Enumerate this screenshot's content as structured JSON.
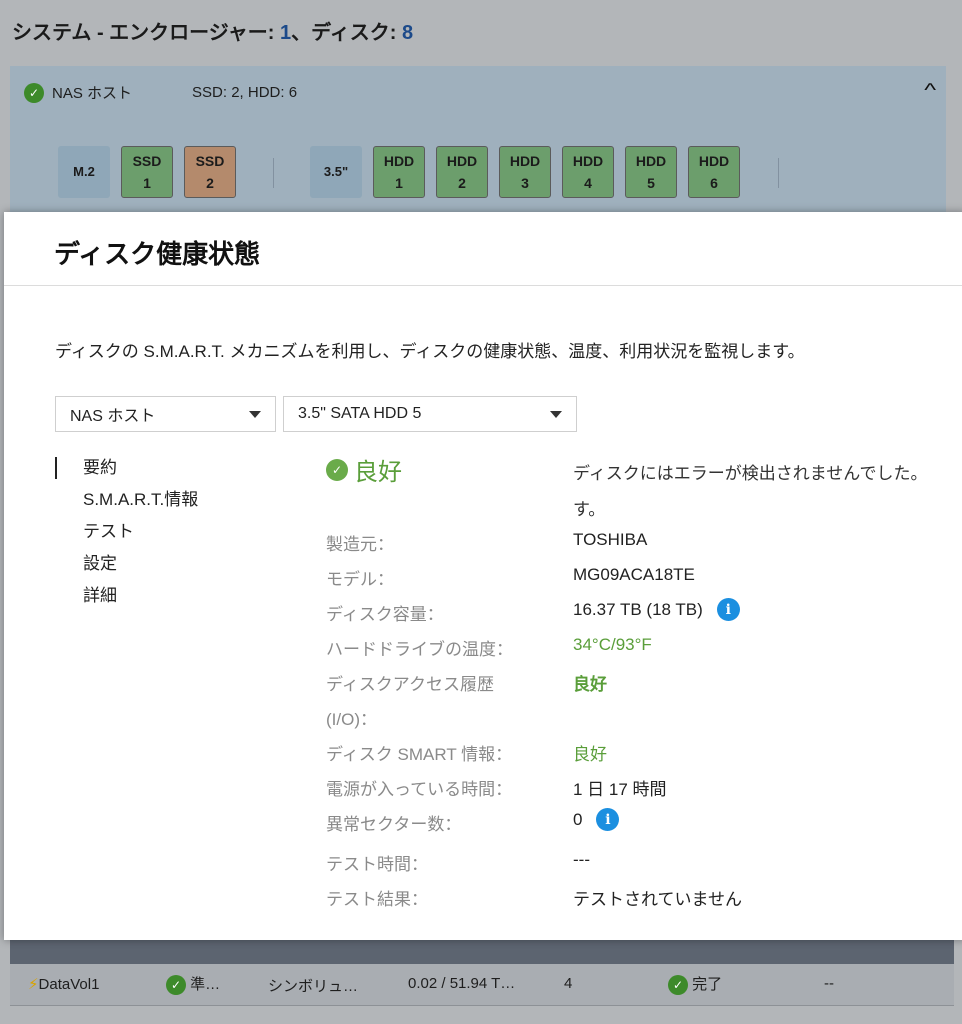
{
  "background": {
    "title_prefix": "システム - エンクロージャー: ",
    "enclosure_count": "1",
    "title_mid": "、ディスク: ",
    "disk_count": "8",
    "host_name": "NAS ホスト",
    "host_summary": "SSD: 2, HDD: 6",
    "bays": [
      {
        "line1": "M.2",
        "line2": "",
        "kind": "label"
      },
      {
        "line1": "SSD",
        "line2": "1",
        "kind": "green"
      },
      {
        "line1": "SSD",
        "line2": "2",
        "kind": "orange"
      },
      {
        "line1": "3.5\"",
        "line2": "",
        "kind": "label"
      },
      {
        "line1": "HDD",
        "line2": "1",
        "kind": "green"
      },
      {
        "line1": "HDD",
        "line2": "2",
        "kind": "green"
      },
      {
        "line1": "HDD",
        "line2": "3",
        "kind": "green"
      },
      {
        "line1": "HDD",
        "line2": "4",
        "kind": "green"
      },
      {
        "line1": "HDD",
        "line2": "5",
        "kind": "green"
      },
      {
        "line1": "HDD",
        "line2": "6",
        "kind": "green"
      }
    ],
    "table_row": {
      "name": "DataVol1",
      "status": "準…",
      "type": "シンボリュ…",
      "capacity": "0.02 / 51.94 T…",
      "snapshots": "4",
      "snapshot_status": "完了",
      "last": "--"
    }
  },
  "modal": {
    "title": "ディスク健康状態",
    "description": "ディスクの S.M.A.R.T. メカニズムを利用し、ディスクの健康状態、温度、利用状況を監視します。",
    "host_select": "NAS ホスト",
    "disk_select": "3.5\" SATA HDD 5",
    "nav": [
      "要約",
      "S.M.A.R.T.情報",
      "テスト",
      "設定",
      "詳細"
    ],
    "status": "良好",
    "status_message_line1": "ディスクにはエラーが検出されませんでした。",
    "status_message_line2": "す。",
    "fields": {
      "manufacturer_label": "製造元：",
      "manufacturer": "TOSHIBA",
      "model_label": "モデル：",
      "model": "MG09ACA18TE",
      "capacity_label": "ディスク容量：",
      "capacity": "16.37 TB (18 TB)",
      "temp_label": "ハードドライブの温度：",
      "temp": "34°C/93°F",
      "access_label_line1": "ディスクアクセス履歴",
      "access_label_line2": "(I/O)：",
      "access": "良好",
      "smart_label": "ディスク SMART 情報：",
      "smart": "良好",
      "power_label": "電源が入っている時間：",
      "power": "1 日 17 時間",
      "bad_sector_label": "異常セクター数：",
      "bad_sector": "0",
      "test_time_label": "テスト時間：",
      "test_time": "---",
      "test_result_label": "テスト結果：",
      "test_result": "テストされていません"
    }
  }
}
